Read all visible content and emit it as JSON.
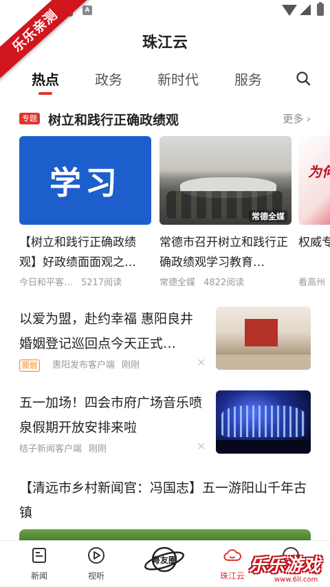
{
  "status_bar": {
    "icon_a": "A"
  },
  "corner_banner": "乐乐亲测",
  "app": {
    "title": "珠江云"
  },
  "tabs": [
    {
      "label": "热点",
      "active": true
    },
    {
      "label": "政务"
    },
    {
      "label": "新时代"
    },
    {
      "label": "服务"
    }
  ],
  "topic": {
    "badge": "专题",
    "title": "树立和践行正确政绩观",
    "more": "更多"
  },
  "cards": [
    {
      "image_text": "学习",
      "title": "【树立和践行正确政绩观】好政绩面面观之…",
      "source": "今日和平客…",
      "reads": "5217阅读"
    },
    {
      "image_text": "常德全媒",
      "title": "常德市召开树立和践行正确政绩观学习教育…",
      "source": "常德全媒",
      "reads": "4822阅读"
    },
    {
      "image_text": "为何",
      "title": "权威专确政绩",
      "source": "看高州",
      "reads": ""
    }
  ],
  "news": [
    {
      "title": "以爱为盟，赴约幸福 惠阳良井婚姻登记巡回点今天正式…",
      "tag": "原创",
      "source": "惠阳发布客户端",
      "time": "刚刚"
    },
    {
      "title": "五一加场！四会市府广场音乐喷泉假期开放安排来啦",
      "tag": "",
      "source": "桔子新闻客户端",
      "time": "刚刚"
    }
  ],
  "feature": {
    "title": "【清远市乡村新闻官：冯国志】五一游阳山千年古镇"
  },
  "bottom_nav": [
    {
      "label": "新闻",
      "icon": "news-icon"
    },
    {
      "label": "视听",
      "icon": "play-icon"
    },
    {
      "label": "粤友圈",
      "icon": "planet-icon"
    },
    {
      "label": "珠江云",
      "icon": "cloud-icon",
      "active": true
    },
    {
      "label": "",
      "icon": "user-icon"
    }
  ],
  "watermark": {
    "text": "乐乐游戏",
    "url": "www.6ll.com"
  },
  "colors": {
    "accent": "#e0332b",
    "orange_tag": "#f08a2b",
    "study_blue": "#1c5fcc"
  }
}
